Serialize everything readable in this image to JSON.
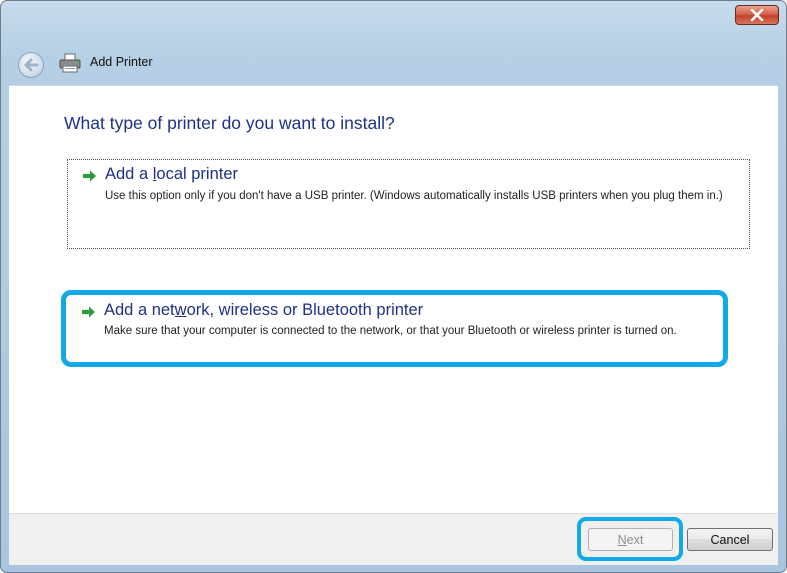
{
  "window": {
    "title": "Add Printer"
  },
  "content": {
    "heading": "What type of printer do you want to install?",
    "options": [
      {
        "title_pre": "Add a ",
        "title_accel": "l",
        "title_post": "ocal printer",
        "description": "Use this option only if you don't have a USB printer. (Windows automatically installs USB printers when you plug them in.)"
      },
      {
        "title_pre": "Add a net",
        "title_accel": "w",
        "title_post": "ork, wireless or Bluetooth printer",
        "description": "Make sure that your computer is connected to the network, or that your Bluetooth or wireless printer is turned on."
      }
    ]
  },
  "footer": {
    "next_accel": "N",
    "next_rest": "ext",
    "cancel_label": "Cancel"
  },
  "colors": {
    "highlight": "#11a9e7",
    "heading": "#1e3287",
    "arrow": "#2a9d3b"
  },
  "icons": [
    "close-icon",
    "back-arrow-icon",
    "printer-icon",
    "green-arrow-icon"
  ]
}
